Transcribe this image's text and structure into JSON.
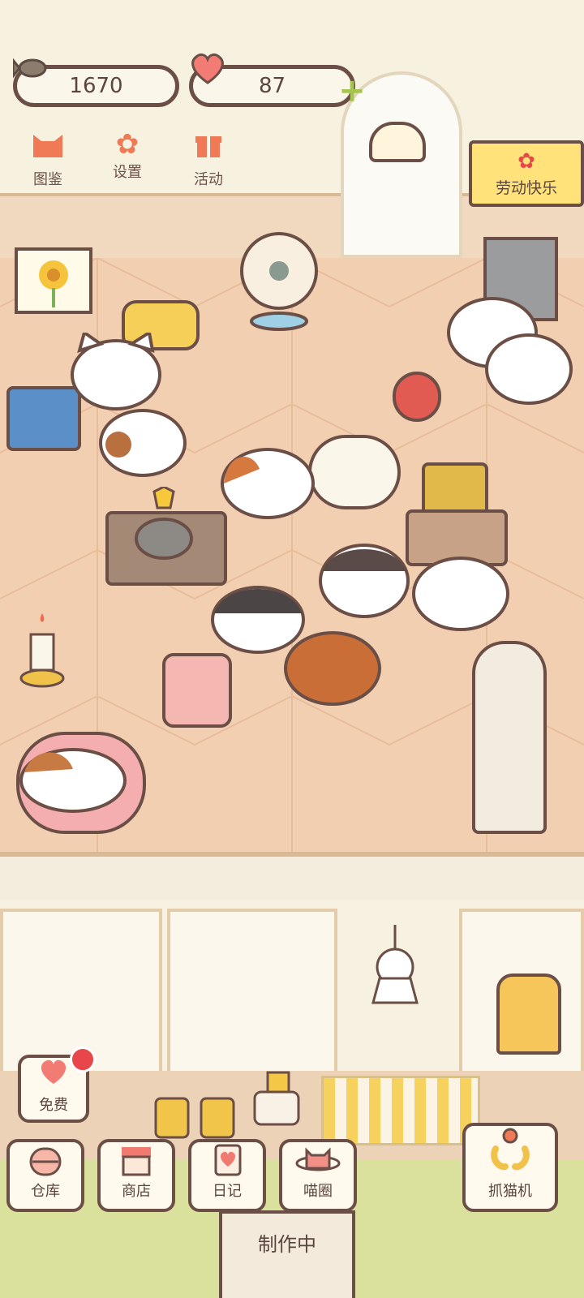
{
  "currency": {
    "fish_amount": "1670",
    "heart_amount": "87",
    "add_symbol": "+"
  },
  "shortcuts": [
    {
      "label": "图鉴",
      "icon": "cat-face-icon"
    },
    {
      "label": "设置",
      "icon": "gear-icon"
    },
    {
      "label": "活动",
      "icon": "gift-icon"
    }
  ],
  "event_banner": {
    "label": "劳动快乐"
  },
  "free_button": {
    "label": "免费"
  },
  "bottom_nav": [
    {
      "label": "仓库",
      "icon": "box-icon"
    },
    {
      "label": "商店",
      "icon": "shop-icon"
    },
    {
      "label": "日记",
      "icon": "diary-icon"
    },
    {
      "label": "喵圈",
      "icon": "planet-cat-icon"
    }
  ],
  "claw_machine": {
    "label": "抓猫机"
  },
  "crafting_sign": {
    "label": "制作中"
  },
  "colors": {
    "outline": "#6b4f46",
    "accent": "#f07a55",
    "badge_red": "#e8464a",
    "floor": "#f3cfb2",
    "banner": "#ffe27a"
  }
}
